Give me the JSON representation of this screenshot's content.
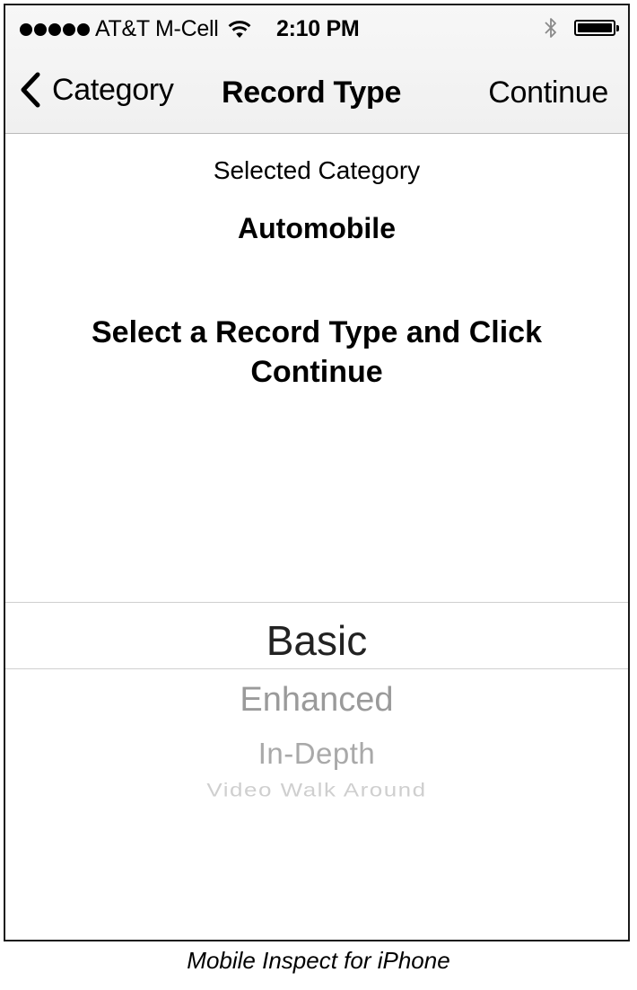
{
  "status_bar": {
    "signal_dots": 5,
    "carrier": "AT&T M-Cell",
    "time": "2:10 PM",
    "icons": [
      "wifi-icon",
      "bluetooth-icon",
      "battery-icon"
    ]
  },
  "nav_bar": {
    "back_label": "Category",
    "title": "Record Type",
    "action_label": "Continue"
  },
  "selected_category": {
    "label": "Selected Category",
    "value": "Automobile"
  },
  "instruction": "Select a Record Type and Click Continue",
  "picker": {
    "selected_index": 0,
    "options": [
      "Basic",
      "Enhanced",
      "In-Depth",
      "Video Walk Around"
    ]
  },
  "caption": "Mobile Inspect for iPhone"
}
